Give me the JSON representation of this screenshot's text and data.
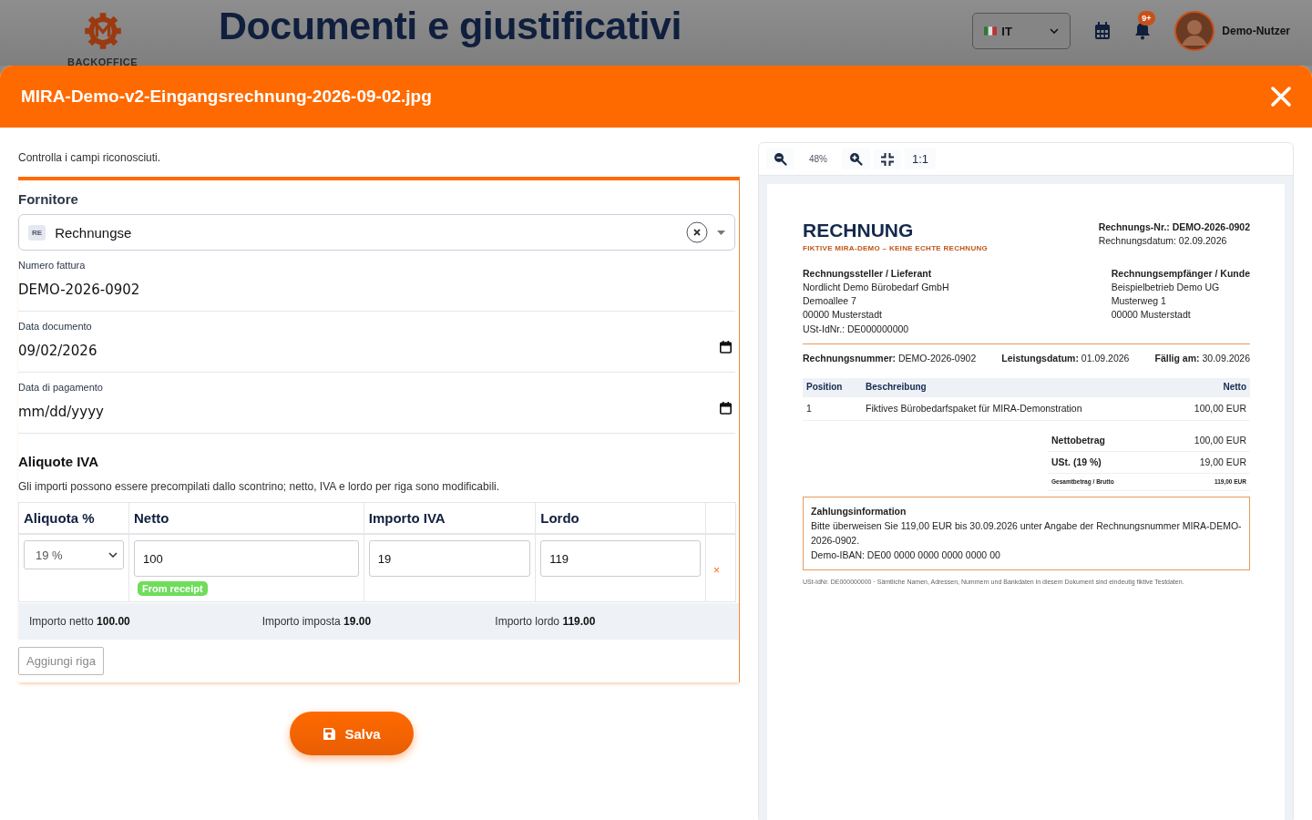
{
  "app_header": {
    "logo_text": "BACKOFFICE",
    "page_title": "Documenti e giustificativi",
    "language": "IT",
    "notification_count": "9+",
    "user_name": "Demo-Nutzer"
  },
  "modal": {
    "title": "MIRA-Demo-v2-Eingangsrechnung-2026-09-02.jpg"
  },
  "form": {
    "hint": "Controlla i campi riconosciuti.",
    "supplier": {
      "label": "Fornitore",
      "badge": "RE",
      "value": "Rechnungse"
    },
    "fields": [
      {
        "kind": "text",
        "label": "Numero fattura",
        "value": "DEMO-2026-0902"
      },
      {
        "kind": "date",
        "label": "Data documento",
        "value": "09/02/2026"
      },
      {
        "kind": "date",
        "label": "Data di pagamento",
        "placeholder": "mm/dd/yyyy"
      }
    ],
    "vat": {
      "title": "Aliquote IVA",
      "note": "Gli importi possono essere precompilati dallo scontrino; netto, IVA e lordo per riga sono modificabili.",
      "columns": [
        "Aliquota %",
        "Netto",
        "Importo IVA",
        "Lordo"
      ],
      "rows": [
        {
          "rate": "19 %",
          "net": "100",
          "net_badge": "From receipt",
          "vat": "19",
          "gross": "119",
          "remove": "×"
        }
      ],
      "totals": [
        {
          "label": "Importo netto",
          "value": "100.00"
        },
        {
          "label": "Importo imposta",
          "value": "19.00"
        },
        {
          "label": "Importo lordo",
          "value": "119.00"
        }
      ],
      "add_button": "Aggiungi riga"
    },
    "save_button": "Salva"
  },
  "preview": {
    "toolbar": {
      "zoom": "48%",
      "actual_size": "1:1"
    },
    "document": {
      "title": "RECHNUNG",
      "subtitle": "FIKTIVE MIRA-DEMO – KEINE ECHTE RECHNUNG",
      "invoice_no_line": "Rechnungs-Nr.: DEMO-2026-0902",
      "date_line": "Rechnungsdatum: 02.09.2026",
      "sender": {
        "heading": "Rechnungssteller / Lieferant",
        "lines": [
          "Nordlicht Demo Bürobedarf GmbH",
          "Demoallee 7",
          "00000 Musterstadt",
          "USt-IdNr.: DE000000000"
        ]
      },
      "recipient": {
        "heading": "Rechnungsempfänger / Kunde",
        "lines": [
          "Beispielbetrieb Demo UG",
          "Musterweg 1",
          "00000 Musterstadt"
        ]
      },
      "info": [
        "**Rechnungsnummer:** DEMO-2026-0902",
        "**Leistungsdatum:** 01.09.2026",
        "**Fällig am:** 30.09.2026"
      ],
      "table": {
        "columns": [
          "Position",
          "Beschreibung",
          "Netto"
        ],
        "rows": [
          [
            "1",
            "Fiktives Bürobedarfspaket für MIRA-Demonstration",
            "100,00 EUR"
          ]
        ]
      },
      "totals": [
        {
          "kind": "normal",
          "label": "Nettobetrag",
          "value": "100,00 EUR"
        },
        {
          "kind": "normal",
          "label": "USt. (19 %)",
          "value": "19,00 EUR"
        },
        {
          "kind": "small",
          "label": "Gesamtbetrag / Brutto",
          "value": "119,00 EUR"
        }
      ],
      "payment": {
        "heading": "Zahlungsinformation",
        "lines": [
          "Bitte überweisen Sie 119,00 EUR bis 30.09.2026 unter Angabe der Rechnungsnummer MIRA-DEMO-2026-0902.",
          "Demo-IBAN: DE00 0000 0000 0000 0000 00"
        ]
      },
      "footer": "USt-IdNr. DE000000000 · Sämtliche Namen, Adressen, Nummern und Bankdaten in diesem Dokument sind eindeutig fiktive Testdaten."
    }
  }
}
